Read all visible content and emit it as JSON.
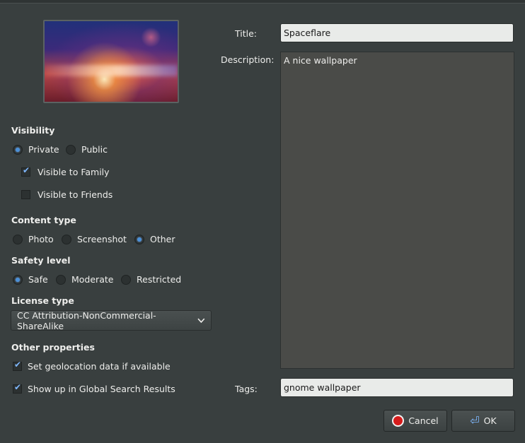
{
  "dialog": {
    "title_label": "Title:",
    "title_value": "Spaceflare",
    "description_label": "Description:",
    "description_value": "A nice wallpaper",
    "tags_label": "Tags:",
    "tags_value": "gnome wallpaper"
  },
  "visibility": {
    "heading": "Visibility",
    "private": "Private",
    "public": "Public",
    "family": "Visible to Family",
    "friends": "Visible to Friends"
  },
  "content_type": {
    "heading": "Content type",
    "photo": "Photo",
    "screenshot": "Screenshot",
    "other": "Other"
  },
  "safety": {
    "heading": "Safety level",
    "safe": "Safe",
    "moderate": "Moderate",
    "restricted": "Restricted"
  },
  "license": {
    "heading": "License type",
    "selected": "CC Attribution-NonCommercial-ShareAlike"
  },
  "other": {
    "heading": "Other properties",
    "geolocation": "Set geolocation data if available",
    "global_search": "Show up in Global Search Results"
  },
  "buttons": {
    "cancel": "Cancel",
    "ok": "OK"
  },
  "icons": {
    "cancel": "stop-icon",
    "ok": "return-arrow-icon",
    "combo": "chevron-down-icon"
  },
  "colors": {
    "background": "#393f3f",
    "accent": "#4a90d9"
  }
}
